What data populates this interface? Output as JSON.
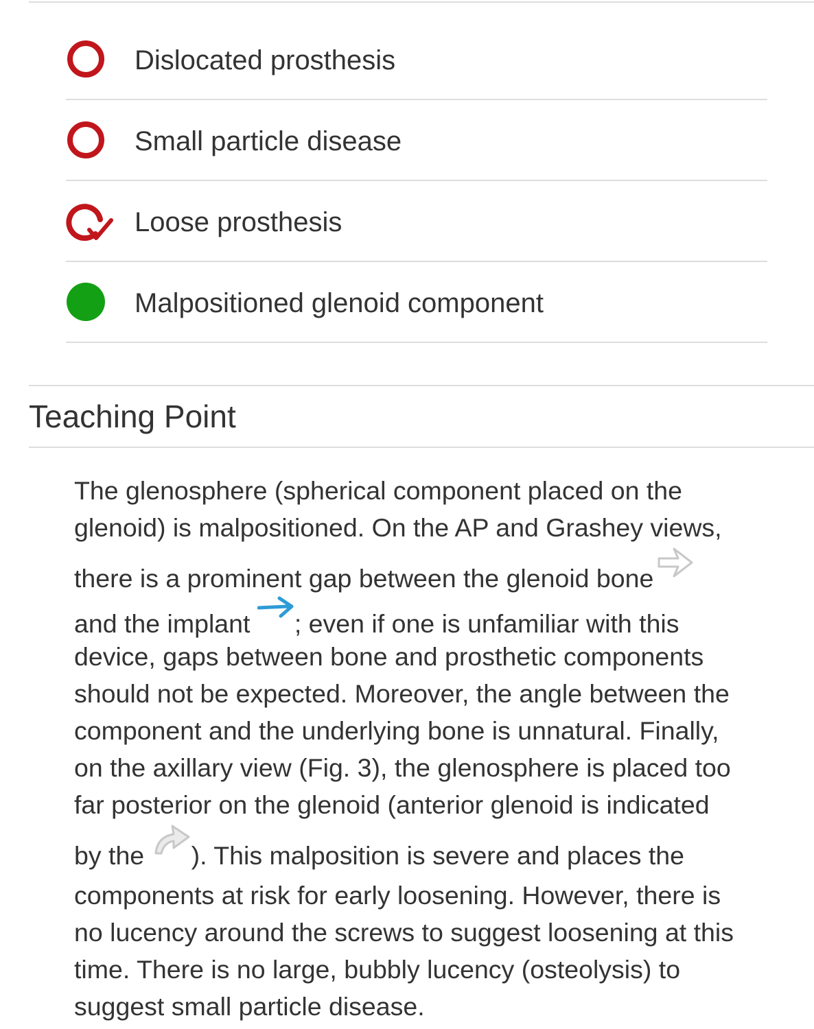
{
  "options": [
    {
      "label": "Dislocated prosthesis",
      "status": "incorrect-unselected",
      "icon": "red-ring-icon"
    },
    {
      "label": "Small particle disease",
      "status": "incorrect-unselected",
      "icon": "red-ring-icon"
    },
    {
      "label": "Loose prosthesis",
      "status": "selected-wrong",
      "icon": "red-ring-check-icon"
    },
    {
      "label": "Malpositioned glenoid component",
      "status": "correct-answer",
      "icon": "green-dot-icon"
    }
  ],
  "colors": {
    "incorrect": "#c0161c",
    "correct": "#14a014",
    "rule": "#dddddd",
    "text": "#333333",
    "blue_arrow": "#2e9bd6",
    "gray_arrow": "#c8c8c8"
  },
  "teaching_point": {
    "title": "Teaching Point",
    "lines": {
      "l1": "The glenosphere (spherical component placed on the",
      "l2": "glenoid) is malpositioned. On the AP and Grashey views,",
      "l3": "there is a prominent gap between the glenoid bone",
      "l4a": "and the implant",
      "l4b": "; even if one is unfamiliar with this",
      "l5": "device, gaps between bone and prosthetic components",
      "l6": "should not be expected. Moreover, the angle between the",
      "l7": "component and the underlying bone is unnatural. Finally,",
      "l8": "on the axillary view (Fig. 3), the glenosphere is placed too",
      "l9": "far posterior on the glenoid (anterior glenoid is indicated",
      "l10a": "by the",
      "l10b": "). This malposition is severe and places the",
      "l11": "components at risk for early loosening. However, there is",
      "l12": "no lucency around the screws to suggest loosening at this",
      "l13": "time. There is no large, bubbly lucency (osteolysis) to",
      "l14": "suggest small particle disease."
    },
    "arrow_icons": [
      "open-gray-arrow-icon",
      "blue-arrow-icon",
      "curved-gray-arrow-icon"
    ]
  }
}
